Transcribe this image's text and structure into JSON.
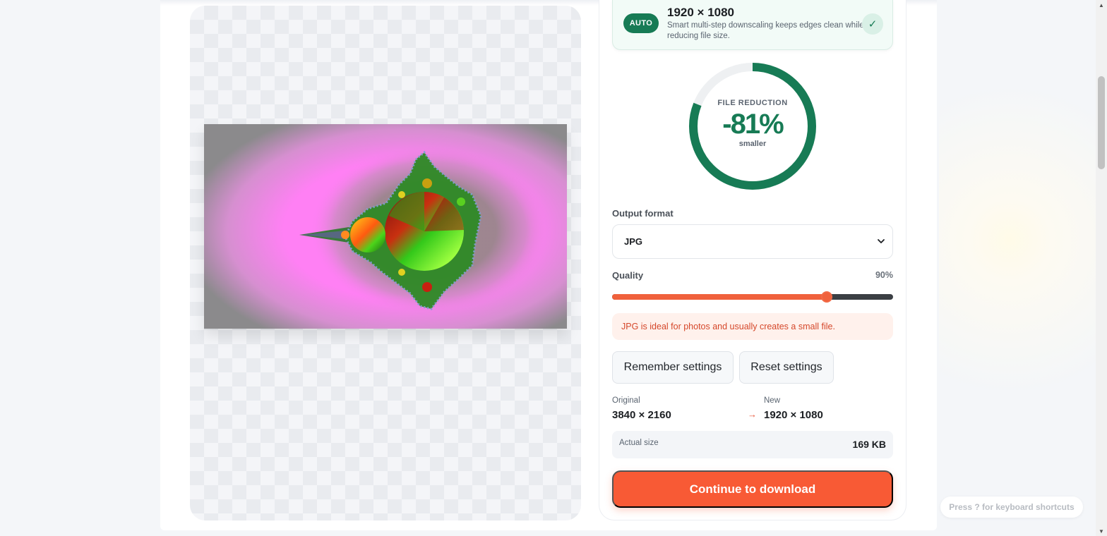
{
  "resize_target": {
    "badge": "AUTO",
    "dimensions": "1920 × 1080",
    "description": "Smart multi-step downscaling keeps edges clean while reducing file size.",
    "check_icon": "✓"
  },
  "reduction": {
    "label": "FILE REDUCTION",
    "value": "-81%",
    "caption": "smaller",
    "fraction": 0.81,
    "color": "#177b55"
  },
  "output_format": {
    "label": "Output format",
    "selected": "JPG",
    "icon": "chevron-down-icon"
  },
  "quality": {
    "label": "Quality",
    "display": "90%",
    "value": 0.765,
    "accent": "#f0613c"
  },
  "hint": "JPG is ideal for photos and usually creates a small file.",
  "buttons": {
    "remember": "Remember settings",
    "reset": "Reset settings",
    "continue": "Continue to download"
  },
  "dimensions": {
    "original_label": "Original",
    "original_value": "3840 × 2160",
    "arrow": "→",
    "new_label": "New",
    "new_value": "1920 × 1080"
  },
  "size": {
    "label": "Actual size",
    "value": "169 KB"
  },
  "shortcut_hint": "Press ? for keyboard shortcuts",
  "scrollbar": {
    "up_icon": "▲",
    "down_icon": "▼"
  }
}
